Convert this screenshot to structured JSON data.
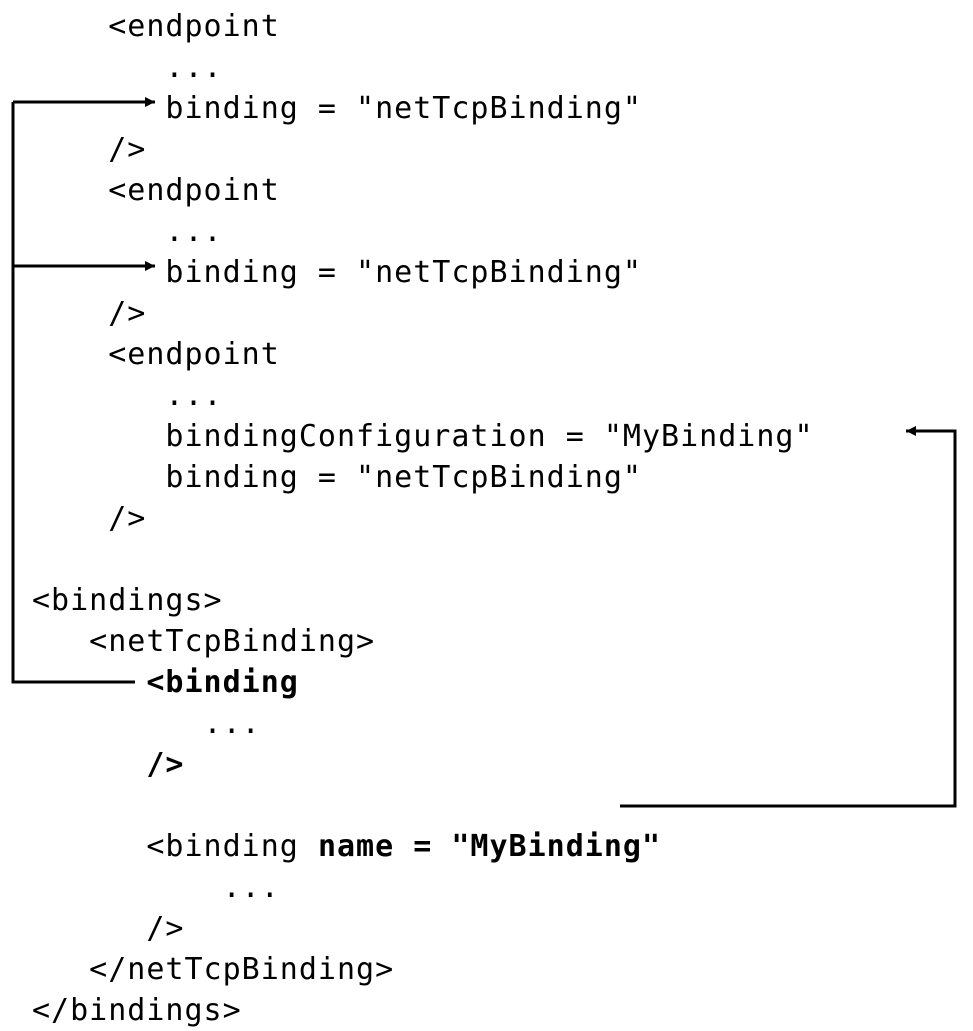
{
  "code": {
    "endpoint1_open": "<endpoint",
    "endpoint1_ellipsis": "   ...",
    "endpoint1_binding": "   binding = \"netTcpBinding\"",
    "endpoint1_close": "/>",
    "endpoint2_open": "<endpoint",
    "endpoint2_ellipsis": "   ...",
    "endpoint2_binding": "   binding = \"netTcpBinding\"",
    "endpoint2_close": "/>",
    "endpoint3_open": "<endpoint",
    "endpoint3_ellipsis": "   ...",
    "endpoint3_cfg": "   bindingConfiguration = \"MyBinding\"",
    "endpoint3_binding": "   binding = \"netTcpBinding\"",
    "endpoint3_close": "/>",
    "bindings_open": "<bindings>",
    "nettcp_open": "   <netTcpBinding>",
    "binding_def_open": "      <binding",
    "binding_def_ellipsis": "         ...",
    "binding_def_close": "      />",
    "binding_named_open_a": "      <binding ",
    "binding_named_open_b": "name = \"MyBinding\"",
    "binding_named_ellipsis": "          ...",
    "binding_named_close": "      />",
    "nettcp_close": "   </netTcpBinding>",
    "bindings_close": "</bindings>"
  },
  "arrows": {
    "default_to_ep1": {
      "from": "default-binding-definition",
      "to": "endpoint-1-binding-attribute"
    },
    "default_to_ep2": {
      "from": "default-binding-definition",
      "to": "endpoint-2-binding-attribute"
    },
    "named_to_ep3": {
      "from": "named-binding-definition",
      "to": "endpoint-3-bindingConfiguration-attribute"
    }
  }
}
